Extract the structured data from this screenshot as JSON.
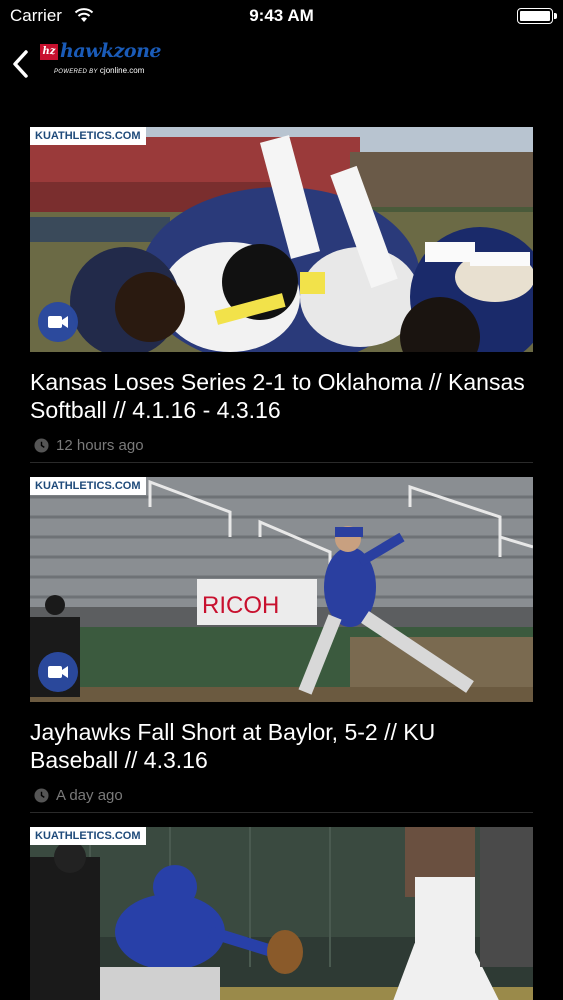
{
  "status_bar": {
    "carrier": "Carrier",
    "time": "9:43 AM"
  },
  "nav": {
    "logo_badge": "hz",
    "logo_name": "hawkzone",
    "logo_powered": "POWERED BY",
    "logo_site": "cjonline.com"
  },
  "articles": [
    {
      "source": "KUATHLETICS.COM",
      "title": "Kansas Loses Series 2-1 to Oklahoma // Kansas Softball // 4.1.16 - 4.3.16",
      "time": "12 hours ago"
    },
    {
      "source": "KUATHLETICS.COM",
      "title": "Jayhawks Fall Short at Baylor, 5-2 // KU Baseball // 4.3.16",
      "time": "A day ago",
      "banner_text": "RICOH"
    },
    {
      "source": "KUATHLETICS.COM"
    }
  ]
}
